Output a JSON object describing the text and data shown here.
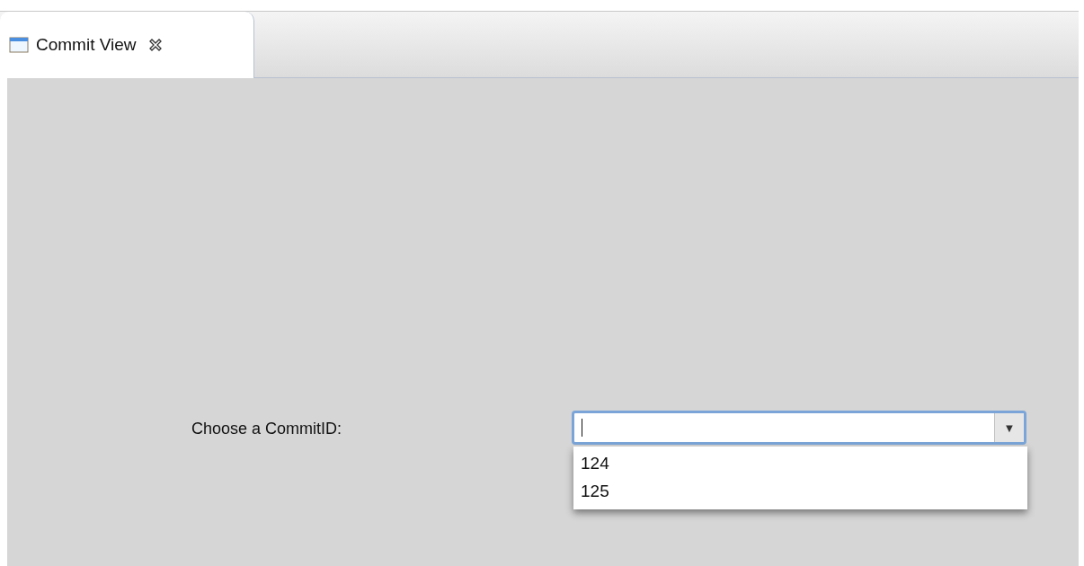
{
  "tabs": [
    {
      "label": "Commit View"
    }
  ],
  "form": {
    "label": "Choose a CommitID:",
    "combo": {
      "arrow": "▼",
      "options": [
        "124",
        "125"
      ]
    }
  }
}
